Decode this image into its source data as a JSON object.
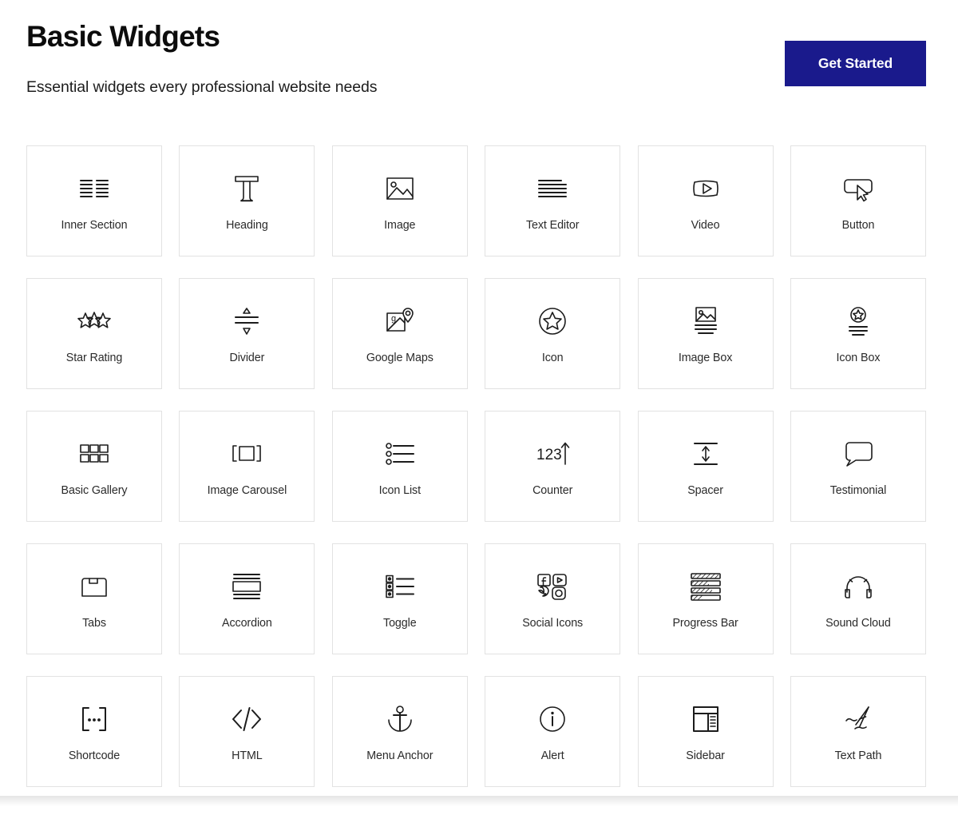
{
  "header": {
    "title": "Basic Widgets",
    "subtitle": "Essential widgets every professional website needs",
    "cta_label": "Get Started",
    "cta_color": "#1a1a8c"
  },
  "theme": {
    "background": "#ffffff",
    "card_border": "#e2e2e2",
    "icon_stroke": "#1c1c1c",
    "label_color": "#2b2b2b",
    "title_color": "#0c0c0c"
  },
  "grid": {
    "columns": 6,
    "rows": 5,
    "widgets": [
      {
        "label": "Inner Section",
        "icon": "inner-section-icon"
      },
      {
        "label": "Heading",
        "icon": "heading-t-icon"
      },
      {
        "label": "Image",
        "icon": "image-picture-icon"
      },
      {
        "label": "Text Editor",
        "icon": "text-lines-icon"
      },
      {
        "label": "Video",
        "icon": "video-play-icon"
      },
      {
        "label": "Button",
        "icon": "button-cursor-icon"
      },
      {
        "label": "Star Rating",
        "icon": "three-stars-icon"
      },
      {
        "label": "Divider",
        "icon": "divider-arrows-icon"
      },
      {
        "label": "Google Maps",
        "icon": "map-pin-icon"
      },
      {
        "label": "Icon",
        "icon": "star-circle-icon"
      },
      {
        "label": "Image Box",
        "icon": "image-box-icon"
      },
      {
        "label": "Icon Box",
        "icon": "icon-box-icon"
      },
      {
        "label": "Basic Gallery",
        "icon": "grid-squares-icon"
      },
      {
        "label": "Image Carousel",
        "icon": "carousel-icon"
      },
      {
        "label": "Icon List",
        "icon": "icon-list-icon"
      },
      {
        "label": "Counter",
        "icon": "counter-123-icon"
      },
      {
        "label": "Spacer",
        "icon": "spacer-arrows-icon"
      },
      {
        "label": "Testimonial",
        "icon": "speech-bubble-icon"
      },
      {
        "label": "Tabs",
        "icon": "tabs-folder-icon"
      },
      {
        "label": "Accordion",
        "icon": "accordion-icon"
      },
      {
        "label": "Toggle",
        "icon": "toggle-list-icon"
      },
      {
        "label": "Social Icons",
        "icon": "social-icons-icon"
      },
      {
        "label": "Progress Bar",
        "icon": "progress-bar-icon"
      },
      {
        "label": "Sound Cloud",
        "icon": "headphones-icon"
      },
      {
        "label": "Shortcode",
        "icon": "shortcode-brackets-icon"
      },
      {
        "label": "HTML",
        "icon": "code-slash-icon"
      },
      {
        "label": "Menu Anchor",
        "icon": "anchor-icon"
      },
      {
        "label": "Alert",
        "icon": "info-circle-icon"
      },
      {
        "label": "Sidebar",
        "icon": "sidebar-layout-icon"
      },
      {
        "label": "Text Path",
        "icon": "text-path-icon"
      }
    ]
  }
}
